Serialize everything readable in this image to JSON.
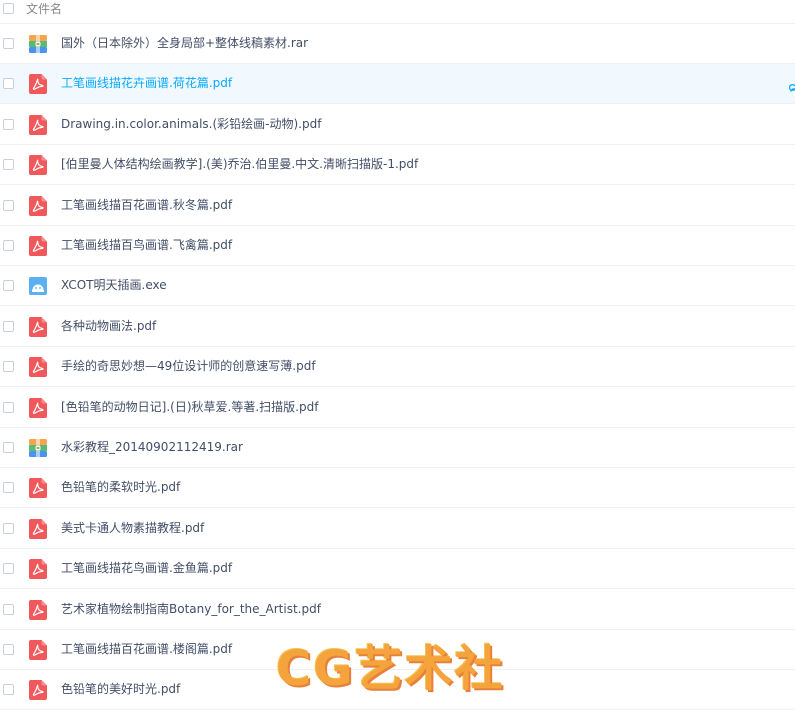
{
  "header": {
    "column_label": "文件名"
  },
  "colors": {
    "accent": "#09aaff",
    "pdf": "#f0585b",
    "archive_top": "#f8a34e",
    "archive_mid": "#54bc74",
    "archive_bottom": "#4b93ee",
    "exe": "#5bb0f2",
    "watermark": "#f4a33d"
  },
  "files": [
    {
      "name": "国外（日本除外）全身局部+整体线稿素材.rar",
      "type": "rar",
      "icon": "archive-icon",
      "selected": false
    },
    {
      "name": "工笔画线描花卉画谱.荷花篇.pdf",
      "type": "pdf",
      "icon": "pdf-icon",
      "selected": true
    },
    {
      "name": "Drawing.in.color.animals.(彩铅绘画-动物).pdf",
      "type": "pdf",
      "icon": "pdf-icon",
      "selected": false
    },
    {
      "name": "[伯里曼人体结构绘画教学].(美)乔治.伯里曼.中文.清晰扫描版-1.pdf",
      "type": "pdf",
      "icon": "pdf-icon",
      "selected": false
    },
    {
      "name": "工笔画线描百花画谱.秋冬篇.pdf",
      "type": "pdf",
      "icon": "pdf-icon",
      "selected": false
    },
    {
      "name": "工笔画线描百鸟画谱.飞禽篇.pdf",
      "type": "pdf",
      "icon": "pdf-icon",
      "selected": false
    },
    {
      "name": "XCOT明天插画.exe",
      "type": "exe",
      "icon": "exe-icon",
      "selected": false
    },
    {
      "name": "各种动物画法.pdf",
      "type": "pdf",
      "icon": "pdf-icon",
      "selected": false
    },
    {
      "name": "手绘的奇思妙想—49位设计师的创意速写薄.pdf",
      "type": "pdf",
      "icon": "pdf-icon",
      "selected": false
    },
    {
      "name": "[色铅笔的动物日记].(日)秋草爱.等著.扫描版.pdf",
      "type": "pdf",
      "icon": "pdf-icon",
      "selected": false
    },
    {
      "name": "水彩教程_20140902112419.rar",
      "type": "rar",
      "icon": "archive-icon",
      "selected": false
    },
    {
      "name": "色铅笔的柔软时光.pdf",
      "type": "pdf",
      "icon": "pdf-icon",
      "selected": false
    },
    {
      "name": "美式卡通人物素描教程.pdf",
      "type": "pdf",
      "icon": "pdf-icon",
      "selected": false
    },
    {
      "name": "工笔画线描花鸟画谱.金鱼篇.pdf",
      "type": "pdf",
      "icon": "pdf-icon",
      "selected": false
    },
    {
      "name": "艺术家植物绘制指南Botany_for_the_Artist.pdf",
      "type": "pdf",
      "icon": "pdf-icon",
      "selected": false
    },
    {
      "name": "工笔画线描百花画谱.楼阁篇.pdf",
      "type": "pdf",
      "icon": "pdf-icon",
      "selected": false
    },
    {
      "name": "色铅笔的美好时光.pdf",
      "type": "pdf",
      "icon": "pdf-icon",
      "selected": false
    }
  ],
  "watermark": {
    "text": "CG艺术社"
  }
}
